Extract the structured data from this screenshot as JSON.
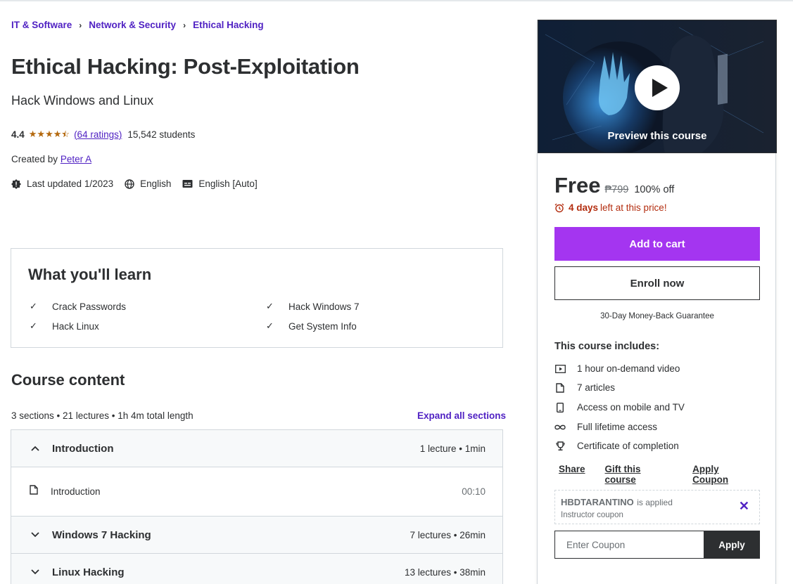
{
  "breadcrumb": [
    {
      "label": "IT & Software"
    },
    {
      "label": "Network & Security"
    },
    {
      "label": "Ethical Hacking"
    }
  ],
  "course": {
    "title": "Ethical Hacking: Post-Exploitation",
    "subtitle": "Hack Windows and Linux",
    "rating": "4.4",
    "stars": 4.5,
    "ratings_count": "(64 ratings)",
    "students": "15,542 students",
    "created_by_label": "Created by",
    "author": "Peter A",
    "last_updated": "Last updated 1/2023",
    "language": "English",
    "captions": "English [Auto]"
  },
  "learn": {
    "title": "What you'll learn",
    "items": [
      "Crack Passwords",
      "Hack Windows 7",
      "Hack Linux",
      "Get System Info"
    ]
  },
  "content": {
    "title": "Course content",
    "summary": "3 sections • 21 lectures • 1h 4m total length",
    "expand_all": "Expand all sections",
    "sections": [
      {
        "title": "Introduction",
        "meta": "1 lecture • 1min",
        "expanded": true,
        "lectures": [
          {
            "title": "Introduction",
            "time": "00:10"
          }
        ]
      },
      {
        "title": "Windows 7 Hacking",
        "meta": "7 lectures • 26min",
        "expanded": false
      },
      {
        "title": "Linux Hacking",
        "meta": "13 lectures • 38min",
        "expanded": false
      }
    ]
  },
  "sidebar": {
    "preview_label": "Preview this course",
    "price": "Free",
    "original_price": "₱799",
    "discount": "100% off",
    "timer_bold": "4 days",
    "timer_rest": "left at this price!",
    "add_to_cart": "Add to cart",
    "enroll_now": "Enroll now",
    "guarantee": "30-Day Money-Back Guarantee",
    "includes_title": "This course includes:",
    "includes": [
      {
        "icon": "video-icon",
        "label": "1 hour on-demand video"
      },
      {
        "icon": "file-icon",
        "label": "7 articles"
      },
      {
        "icon": "mobile-icon",
        "label": "Access on mobile and TV"
      },
      {
        "icon": "infinity-icon",
        "label": "Full lifetime access"
      },
      {
        "icon": "trophy-icon",
        "label": "Certificate of completion"
      }
    ],
    "share": "Share",
    "gift": "Gift this course",
    "apply_coupon": "Apply Coupon",
    "coupon_code": "HBDTARANTINO",
    "coupon_applied": "is applied",
    "coupon_kind": "Instructor coupon",
    "coupon_placeholder": "Enter Coupon",
    "apply": "Apply"
  },
  "colors": {
    "accent": "#5022c3",
    "cart_button": "#a435f0",
    "star": "#b4690e",
    "timer": "#b32d0f",
    "text": "#2d2f31"
  }
}
